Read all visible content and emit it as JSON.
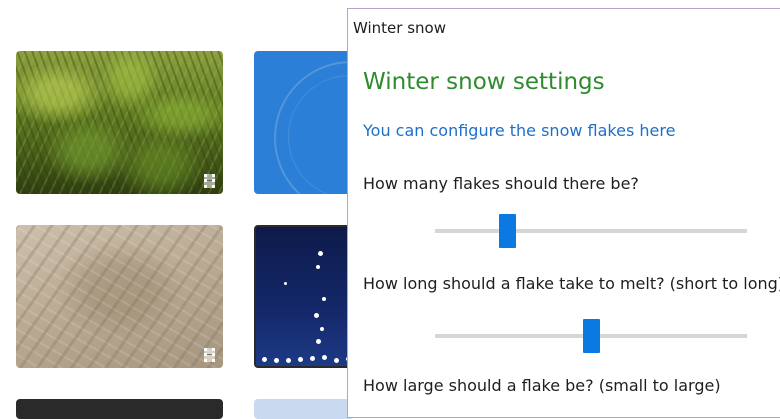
{
  "flyout": {
    "title": "Winter snow",
    "heading": "Winter snow settings",
    "link": "You can configure the snow flakes here",
    "questions": {
      "flake_count": "How many flakes should there be?",
      "melt_time": "How long should a flake take to melt? (short to long)",
      "flake_size": "How large should a flake be? (small to large)"
    },
    "sliders": {
      "flake_count": 0.23,
      "melt_time": 0.5
    },
    "colors": {
      "heading": "#2e8b2e",
      "link": "#1f6fc9",
      "slider_thumb": "#0a7ae2",
      "flyout_border": "#b9a0c9"
    }
  },
  "gallery": {
    "tiles": [
      {
        "name": "pineapple-field",
        "icon": "film-icon"
      },
      {
        "name": "blue-abstract"
      },
      {
        "name": "sand-ripples",
        "icon": "film-icon"
      },
      {
        "name": "winter-snow"
      },
      {
        "name": "dark-tile"
      },
      {
        "name": "light-tile"
      }
    ]
  }
}
